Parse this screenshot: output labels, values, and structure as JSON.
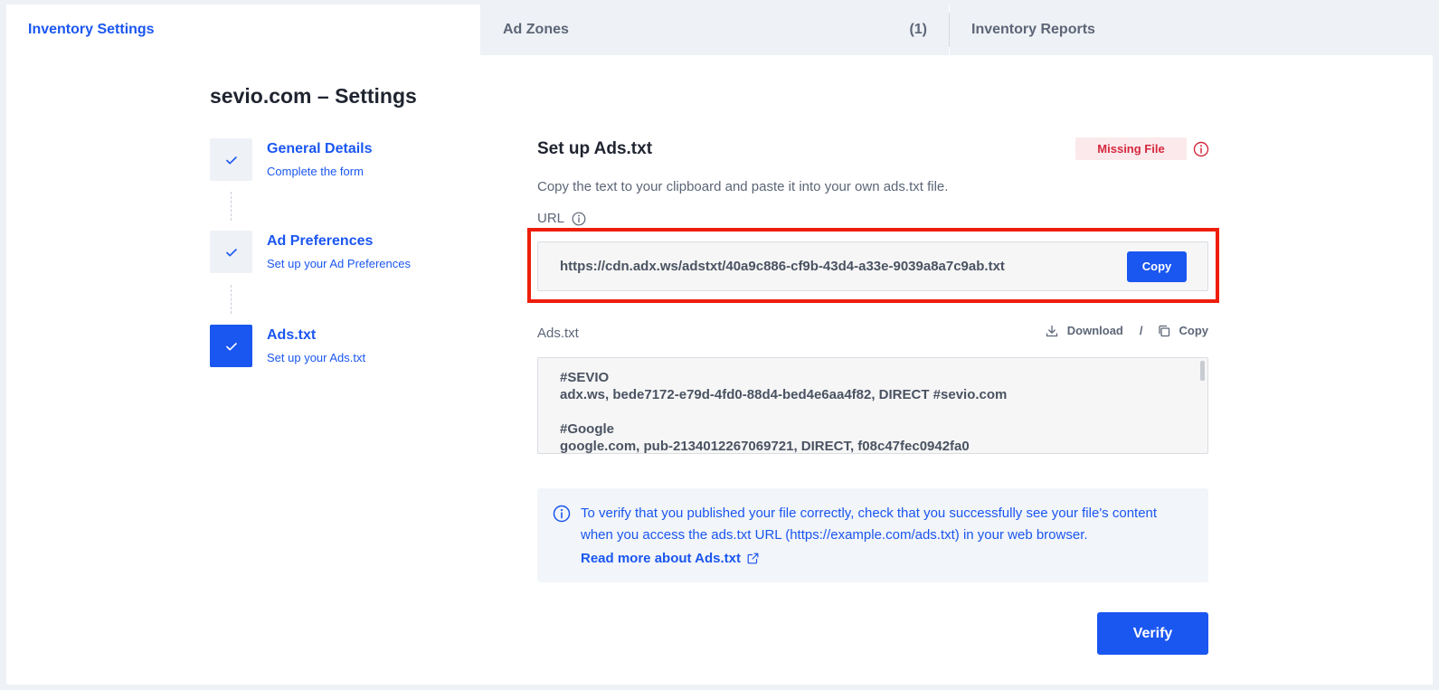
{
  "tabs": {
    "inventory_settings": "Inventory Settings",
    "ad_zones": "Ad Zones",
    "ad_zones_count": "(1)",
    "inventory_reports": "Inventory Reports"
  },
  "page_title": "sevio.com – Settings",
  "steps": [
    {
      "title": "General Details",
      "subtitle": "Complete the form"
    },
    {
      "title": "Ad Preferences",
      "subtitle": "Set up your Ad Preferences"
    },
    {
      "title": "Ads.txt",
      "subtitle": "Set up your Ads.txt"
    }
  ],
  "adstxt": {
    "title": "Set up Ads.txt",
    "status_badge": "Missing File",
    "description": "Copy the text to your clipboard and paste it into your own ads.txt file.",
    "url_label": "URL",
    "url_value": "https://cdn.adx.ws/adstxt/40a9c886-cf9b-43d4-a33e-9039a8a7c9ab.txt",
    "copy_label": "Copy",
    "ads_label": "Ads.txt",
    "download_label": "Download",
    "separator": "/",
    "copy2_label": "Copy",
    "lines": [
      "#SEVIO",
      "adx.ws, bede7172-e79d-4fd0-88d4-bed4e6aa4f82, DIRECT #sevio.com",
      "",
      "#Google",
      "google.com, pub-2134012267069721, DIRECT, f08c47fec0942fa0"
    ],
    "info_text": "To verify that you published your file correctly, check that you successfully see your file's content when you access the ads.txt URL (https://example.com/ads.txt) in your web browser.",
    "info_link": "Read more about Ads.txt",
    "verify_label": "Verify"
  },
  "colors": {
    "accent": "#1a56f0",
    "danger": "#d6283e",
    "highlight": "#ee1e0b"
  }
}
